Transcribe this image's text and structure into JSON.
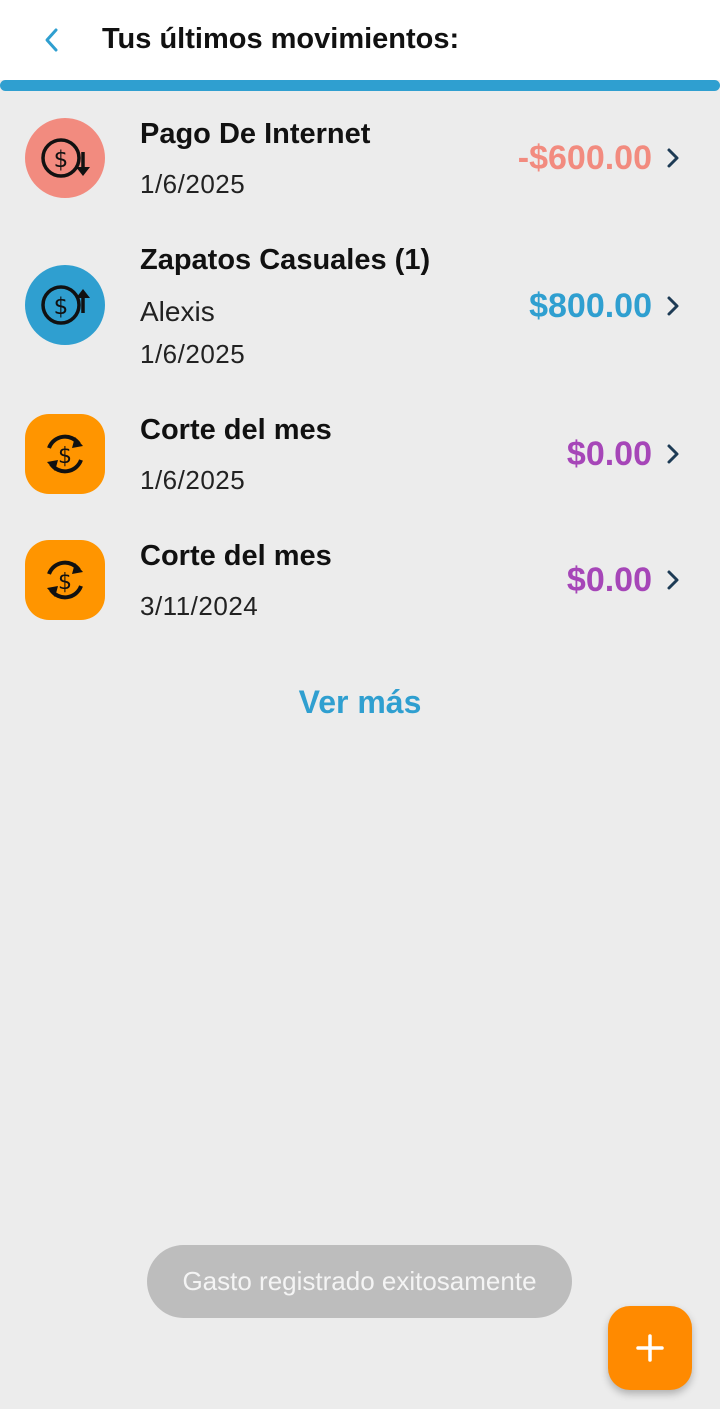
{
  "header": {
    "title": "Tus últimos movimientos:",
    "back_icon": "chevron-left-icon"
  },
  "colors": {
    "accent": "#2f9fd0",
    "expense": "#f28b7f",
    "income": "#2f9fd0",
    "cutoff": "#a646b8",
    "fab": "#ff8a00"
  },
  "movements": [
    {
      "title": "Pago De Internet",
      "subtitle": "",
      "date": "1/6/2025",
      "amount": "-$600.00",
      "icon": "money-out-icon"
    },
    {
      "title": "Zapatos Casuales (1)",
      "subtitle": "Alexis",
      "date": "1/6/2025",
      "amount": "$800.00",
      "icon": "money-in-icon"
    },
    {
      "title": "Corte del mes",
      "subtitle": "",
      "date": "1/6/2025",
      "amount": "$0.00",
      "icon": "money-cycle-icon"
    },
    {
      "title": "Corte del mes",
      "subtitle": "",
      "date": "3/11/2024",
      "amount": "$0.00",
      "icon": "money-cycle-icon"
    }
  ],
  "ver_mas": "Ver más",
  "toast": "Gasto registrado exitosamente",
  "fab": {
    "icon": "plus-icon"
  }
}
